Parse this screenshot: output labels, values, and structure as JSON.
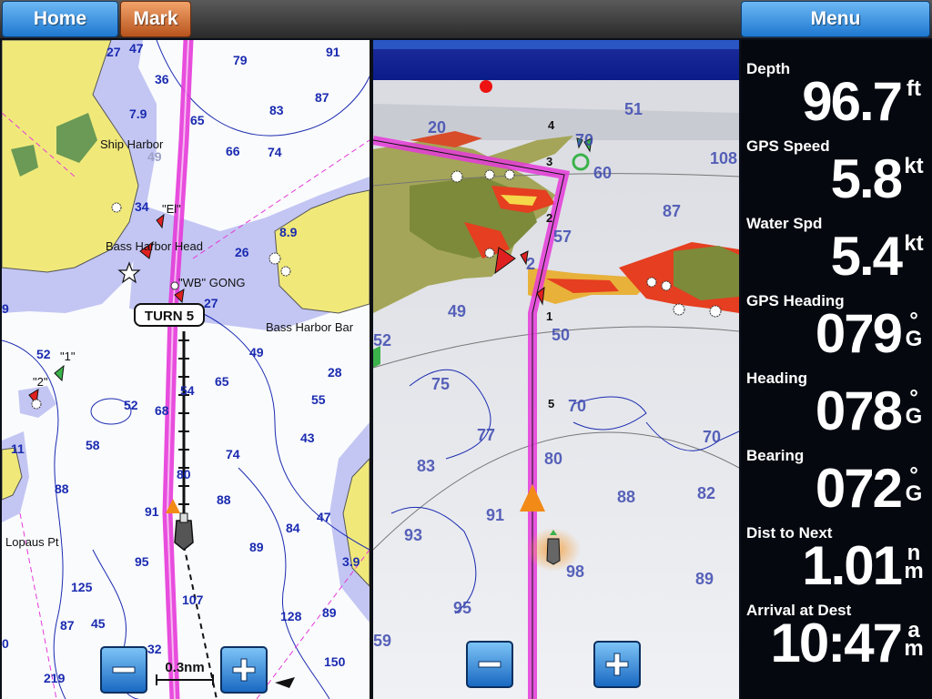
{
  "toolbar": {
    "home_label": "Home",
    "mark_label": "Mark",
    "menu_label": "Menu"
  },
  "chart_2d": {
    "turn_callout": "TURN 5",
    "scale_label": "0.3nm",
    "place_labels": {
      "ship_harbor": "Ship Harbor",
      "bass_harbor_head": "Bass Harbor Head",
      "wb_gong": "\"WB\" GONG",
      "bass_harbor_bar": "Bass Harbor Bar",
      "lopaus_pt": "Lopaus Pt",
      "buoy_el": "\"El\"",
      "buoy_1": "\"1\"",
      "buoy_2": "\"2\""
    },
    "soundings": [
      "27",
      "47",
      "91",
      "36",
      "79",
      "87",
      "7.9",
      "83",
      "65",
      "66",
      "74",
      "49",
      "34",
      "8.9",
      "26",
      "27",
      "9",
      "49",
      "52",
      "54",
      "65",
      "28",
      "52",
      "68",
      "55",
      "11",
      "58",
      "74",
      "43",
      "88",
      "80",
      "88",
      "91",
      "84",
      "47",
      "95",
      "89",
      "3.9",
      "125",
      "107",
      "128",
      "87",
      "45",
      "89",
      "32",
      "150",
      "219",
      "0"
    ]
  },
  "chart_3d": {
    "route_points": [
      "4",
      "3",
      "2",
      "1",
      "5"
    ],
    "soundings": [
      "20",
      "51",
      "70",
      "60",
      "108",
      "87",
      "57",
      "2",
      "49",
      "50",
      "52",
      "75",
      "70",
      "77",
      "70",
      "83",
      "80",
      "88",
      "82",
      "91",
      "93",
      "98",
      "89",
      "95",
      "59"
    ]
  },
  "data_fields": [
    {
      "label": "Depth",
      "value": "96.7",
      "unit": "ft"
    },
    {
      "label": "GPS Speed",
      "value": "5.8",
      "unit": "kt"
    },
    {
      "label": "Water Spd",
      "value": "5.4",
      "unit": "kt"
    },
    {
      "label": "GPS Heading",
      "value": "079",
      "unit": "°G"
    },
    {
      "label": "Heading",
      "value": "078",
      "unit": "°G"
    },
    {
      "label": "Bearing",
      "value": "072",
      "unit": "°G"
    },
    {
      "label": "Dist to Next",
      "value": "1.01",
      "unit": "nm"
    },
    {
      "label": "Arrival at Dest",
      "value": "10:47",
      "unit": "am"
    }
  ],
  "colors": {
    "land": "#f0e97a",
    "shallow": "#c3c6f3",
    "route": "#e53ad9",
    "button_blue": "#2a86de",
    "mark_orange": "#d9692a"
  }
}
